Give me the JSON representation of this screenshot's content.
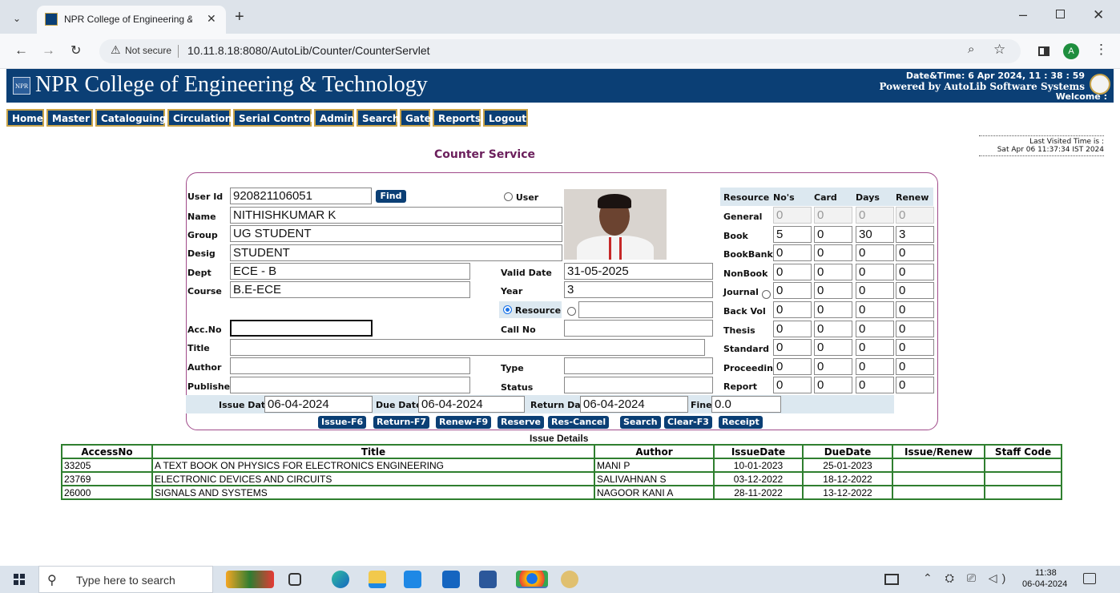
{
  "browser": {
    "tab_title": "NPR College of Engineering & T",
    "url_security": "Not secure",
    "url": "10.11.8.18:8080/AutoLib/Counter/CounterServlet",
    "profile_initial": "A"
  },
  "header": {
    "college": "NPR College of Engineering & Technology",
    "logo_text": "NPR",
    "datetime": "Date&Time:  6 Apr 2024, 11 : 38 : 59",
    "powered": "Powered by AutoLib Software Systems",
    "welcome": "Welcome  :"
  },
  "menu": [
    "Home",
    "Master",
    "Cataloguing",
    "Circulation",
    "Serial Control",
    "Admin",
    "Search",
    "Gate",
    "Reports",
    "Logout"
  ],
  "last_visited": {
    "label": "Last Visited Time is :",
    "value": "Sat Apr 06 11:37:34 IST 2024"
  },
  "page_title": "Counter Service",
  "form": {
    "user_id_label": "User Id",
    "user_id": "920821106051",
    "find": "Find",
    "user_radio": "User",
    "name_label": "Name",
    "name": "NITHISHKUMAR K",
    "group_label": "Group",
    "group": "UG STUDENT",
    "desig_label": "Desig",
    "desig": "STUDENT",
    "dept_label": "Dept",
    "dept": "ECE - B",
    "course_label": "Course",
    "course": "B.E-ECE",
    "valid_label": "Valid Date",
    "valid": "31-05-2025",
    "year_label": "Year",
    "year": "3",
    "resource_radio": "Resource",
    "accno_label": "Acc.No",
    "callno_label": "Call No",
    "title_label": "Title",
    "author_label": "Author",
    "type_label": "Type",
    "publisher_label": "Publisher",
    "status_label": "Status",
    "issue_date_label": "Issue Date",
    "issue_date": "06-04-2024",
    "due_date_label": "Due Date",
    "due_date": "06-04-2024",
    "return_date_label": "Return Date",
    "return_date": "06-04-2024",
    "fine_label": "Fine",
    "fine": "0.0"
  },
  "resources": {
    "headers": [
      "Resource",
      "No's",
      "Card",
      "Days",
      "Renew"
    ],
    "rows": [
      {
        "name": "General",
        "v": [
          "0",
          "0",
          "0",
          "0"
        ]
      },
      {
        "name": "Book",
        "v": [
          "5",
          "0",
          "30",
          "3"
        ]
      },
      {
        "name": "BookBank",
        "v": [
          "0",
          "0",
          "0",
          "0"
        ]
      },
      {
        "name": "NonBook",
        "v": [
          "0",
          "0",
          "0",
          "0"
        ]
      },
      {
        "name": "Journal",
        "v": [
          "0",
          "0",
          "0",
          "0"
        ]
      },
      {
        "name": "Back Vol",
        "v": [
          "0",
          "0",
          "0",
          "0"
        ]
      },
      {
        "name": "Thesis",
        "v": [
          "0",
          "0",
          "0",
          "0"
        ]
      },
      {
        "name": "Standard",
        "v": [
          "0",
          "0",
          "0",
          "0"
        ]
      },
      {
        "name": "Proceeding",
        "v": [
          "0",
          "0",
          "0",
          "0"
        ]
      },
      {
        "name": "Report",
        "v": [
          "0",
          "0",
          "0",
          "0"
        ]
      }
    ]
  },
  "actions": [
    "Issue-F6",
    "Return-F7",
    "Renew-F9",
    "Reserve",
    "Res-Cancel",
    "Search",
    "Clear-F3",
    "Receipt"
  ],
  "issue_details": {
    "caption": "Issue Details",
    "headers": [
      "AccessNo",
      "Title",
      "Author",
      "IssueDate",
      "DueDate",
      "Issue/Renew",
      "Staff Code"
    ],
    "rows": [
      [
        "33205",
        "A TEXT BOOK ON PHYSICS FOR ELECTRONICS ENGINEERING",
        "MANI P",
        "10-01-2023",
        "25-01-2023",
        "",
        ""
      ],
      [
        "23769",
        "ELECTRONIC DEVICES AND CIRCUITS",
        "SALIVAHNAN S",
        "03-12-2022",
        "18-12-2022",
        "",
        ""
      ],
      [
        "26000",
        "SIGNALS AND SYSTEMS",
        "NAGOOR KANI A",
        "28-11-2022",
        "13-12-2022",
        "",
        ""
      ]
    ]
  },
  "taskbar": {
    "search_placeholder": "Type here to search",
    "time": "11:38",
    "date": "06-04-2024"
  }
}
